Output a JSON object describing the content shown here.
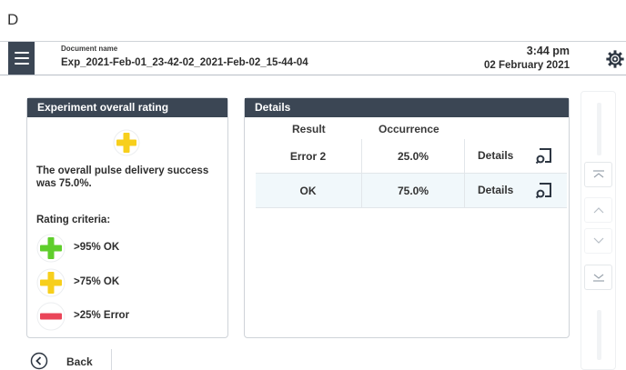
{
  "corner_label": "D",
  "header": {
    "doc_label": "Document name",
    "doc_name": "Exp_2021-Feb-01_23-42-02_2021-Feb-02_15-44-04",
    "time": "3:44 pm",
    "date": "02 February 2021",
    "menu_icon": "hamburger-menu-icon",
    "settings_icon": "gear-icon"
  },
  "rating_panel": {
    "title": "Experiment overall rating",
    "rating_icon": "plus-icon",
    "summary": "The overall pulse delivery success was 75.0%.",
    "criteria_title": "Rating criteria:",
    "criteria": [
      {
        "label": ">95% OK",
        "icon": "plus-icon",
        "color": "#5fce2c"
      },
      {
        "label": ">75% OK",
        "icon": "plus-icon",
        "color": "#f7cf1c"
      },
      {
        "label": ">25% Error",
        "icon": "minus-icon",
        "color": "#ea4559"
      }
    ]
  },
  "details_panel": {
    "title": "Details",
    "columns": [
      "Result",
      "Occurrence"
    ],
    "rows": [
      {
        "result": "Error 2",
        "occurrence": "25.0%",
        "action": "Details"
      },
      {
        "result": "OK",
        "occurrence": "75.0%",
        "action": "Details"
      }
    ]
  },
  "footer": {
    "back_label": "Back"
  },
  "colors": {
    "header_dark": "#3b4654",
    "accent_yellow": "#f7cf1c",
    "accent_green": "#5fce2c",
    "accent_red": "#ea4559"
  }
}
